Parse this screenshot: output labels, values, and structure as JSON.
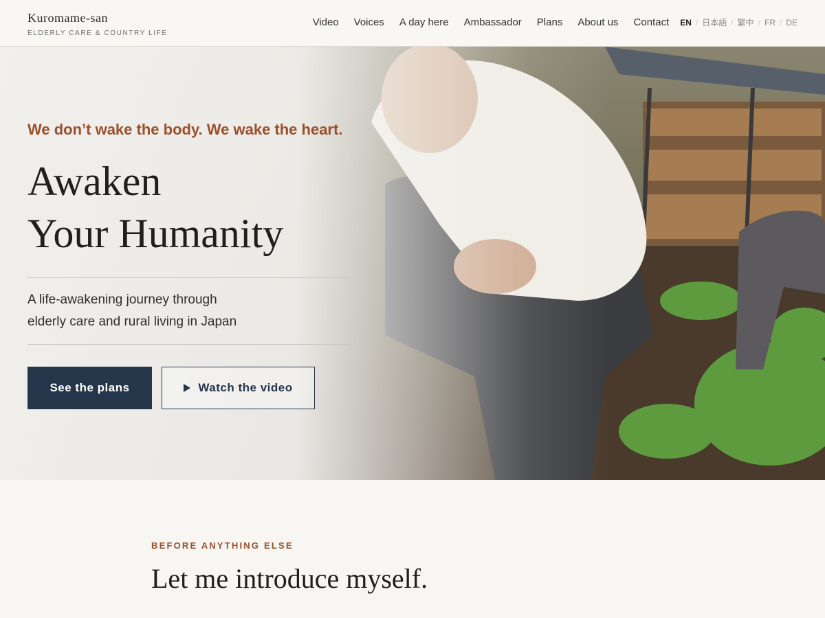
{
  "brand": {
    "name": "Kuromame-san",
    "tagline": "ELDERLY CARE & COUNTRY LIFE"
  },
  "nav": {
    "links": [
      "Video",
      "Voices",
      "A day here",
      "Ambassador",
      "Plans",
      "About us",
      "Contact"
    ],
    "languages": [
      "EN",
      "日本語",
      "繁中",
      "FR",
      "DE"
    ],
    "active_language": "EN"
  },
  "hero": {
    "kicker": "We don’t wake the body. We wake the heart.",
    "headline_line1": "Awaken",
    "headline_line2": "Your Humanity",
    "subtitle_line1": "A life-awakening journey through",
    "subtitle_line2": "elderly care and rural living in Japan",
    "primary_button": "See the plans",
    "secondary_button": "Watch the video",
    "secondary_icon": "play-icon"
  },
  "intro": {
    "eyebrow": "BEFORE ANYTHING ELSE",
    "title": "Let me introduce myself."
  },
  "colors": {
    "accent": "#9a4f2c",
    "navy": "#25364b",
    "background": "#f7f6f3"
  }
}
